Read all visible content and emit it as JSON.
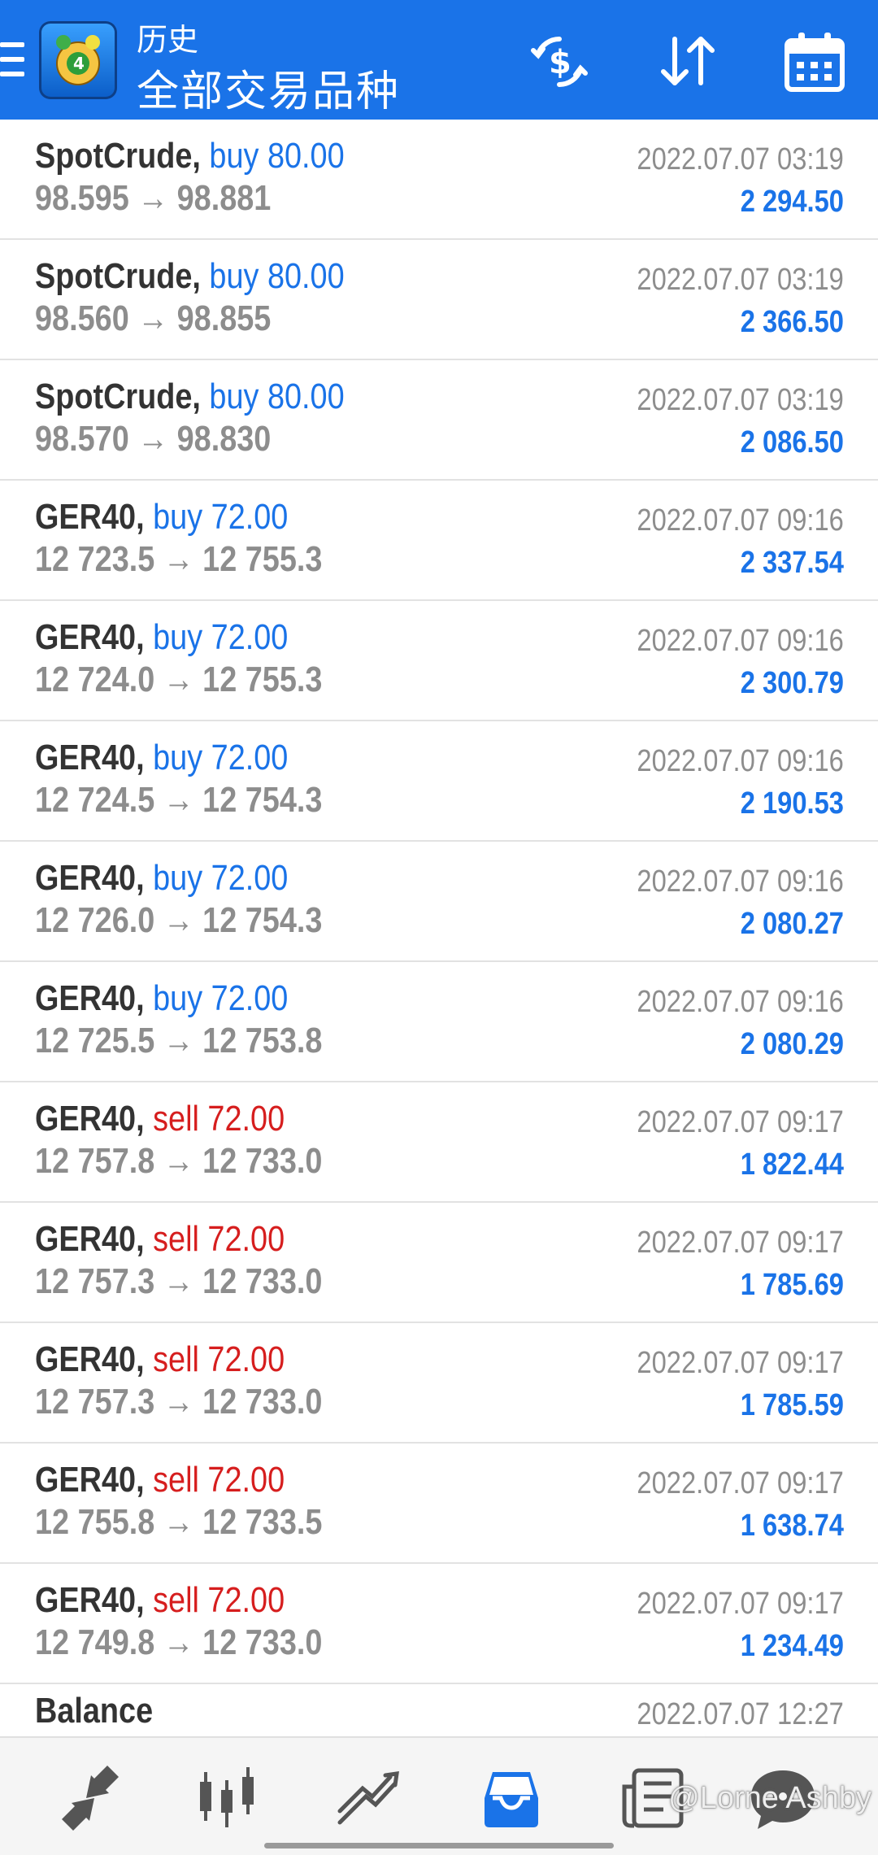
{
  "header": {
    "subtitle": "历史",
    "title": "全部交易品种"
  },
  "trades": [
    {
      "symbol": "SpotCrude,",
      "side": "buy",
      "volume": "buy 80.00",
      "prices": "98.595 → 98.881",
      "time": "2022.07.07 03:19",
      "profit": "2 294.50"
    },
    {
      "symbol": "SpotCrude,",
      "side": "buy",
      "volume": "buy 80.00",
      "prices": "98.560 → 98.855",
      "time": "2022.07.07 03:19",
      "profit": "2 366.50"
    },
    {
      "symbol": "SpotCrude,",
      "side": "buy",
      "volume": "buy 80.00",
      "prices": "98.570 → 98.830",
      "time": "2022.07.07 03:19",
      "profit": "2 086.50"
    },
    {
      "symbol": "GER40,",
      "side": "buy",
      "volume": "buy 72.00",
      "prices": "12 723.5 → 12 755.3",
      "time": "2022.07.07 09:16",
      "profit": "2 337.54"
    },
    {
      "symbol": "GER40,",
      "side": "buy",
      "volume": "buy 72.00",
      "prices": "12 724.0 → 12 755.3",
      "time": "2022.07.07 09:16",
      "profit": "2 300.79"
    },
    {
      "symbol": "GER40,",
      "side": "buy",
      "volume": "buy 72.00",
      "prices": "12 724.5 → 12 754.3",
      "time": "2022.07.07 09:16",
      "profit": "2 190.53"
    },
    {
      "symbol": "GER40,",
      "side": "buy",
      "volume": "buy 72.00",
      "prices": "12 726.0 → 12 754.3",
      "time": "2022.07.07 09:16",
      "profit": "2 080.27"
    },
    {
      "symbol": "GER40,",
      "side": "buy",
      "volume": "buy 72.00",
      "prices": "12 725.5 → 12 753.8",
      "time": "2022.07.07 09:16",
      "profit": "2 080.29"
    },
    {
      "symbol": "GER40,",
      "side": "sell",
      "volume": "sell 72.00",
      "prices": "12 757.8 → 12 733.0",
      "time": "2022.07.07 09:17",
      "profit": "1 822.44"
    },
    {
      "symbol": "GER40,",
      "side": "sell",
      "volume": "sell 72.00",
      "prices": "12 757.3 → 12 733.0",
      "time": "2022.07.07 09:17",
      "profit": "1 785.69"
    },
    {
      "symbol": "GER40,",
      "side": "sell",
      "volume": "sell 72.00",
      "prices": "12 757.3 → 12 733.0",
      "time": "2022.07.07 09:17",
      "profit": "1 785.59"
    },
    {
      "symbol": "GER40,",
      "side": "sell",
      "volume": "sell 72.00",
      "prices": "12 755.8 → 12 733.5",
      "time": "2022.07.07 09:17",
      "profit": "1 638.74"
    },
    {
      "symbol": "GER40,",
      "side": "sell",
      "volume": "sell 72.00",
      "prices": "12 749.8 → 12 733.0",
      "time": "2022.07.07 09:17",
      "profit": "1 234.49"
    }
  ],
  "balance": {
    "label": "Balance",
    "time": "2022.07.07 12:27"
  },
  "bottom_nav": {
    "items": [
      "quotes-icon",
      "chart-candles-icon",
      "trade-icon",
      "history-icon",
      "news-icon",
      "chat-icon"
    ],
    "active": "history-icon"
  },
  "watermark": "@Lorne Ashby",
  "colors": {
    "accent": "#1a73e8",
    "buy": "#1a73e8",
    "sell": "#d61e1e",
    "muted": "#8d8d8d"
  }
}
